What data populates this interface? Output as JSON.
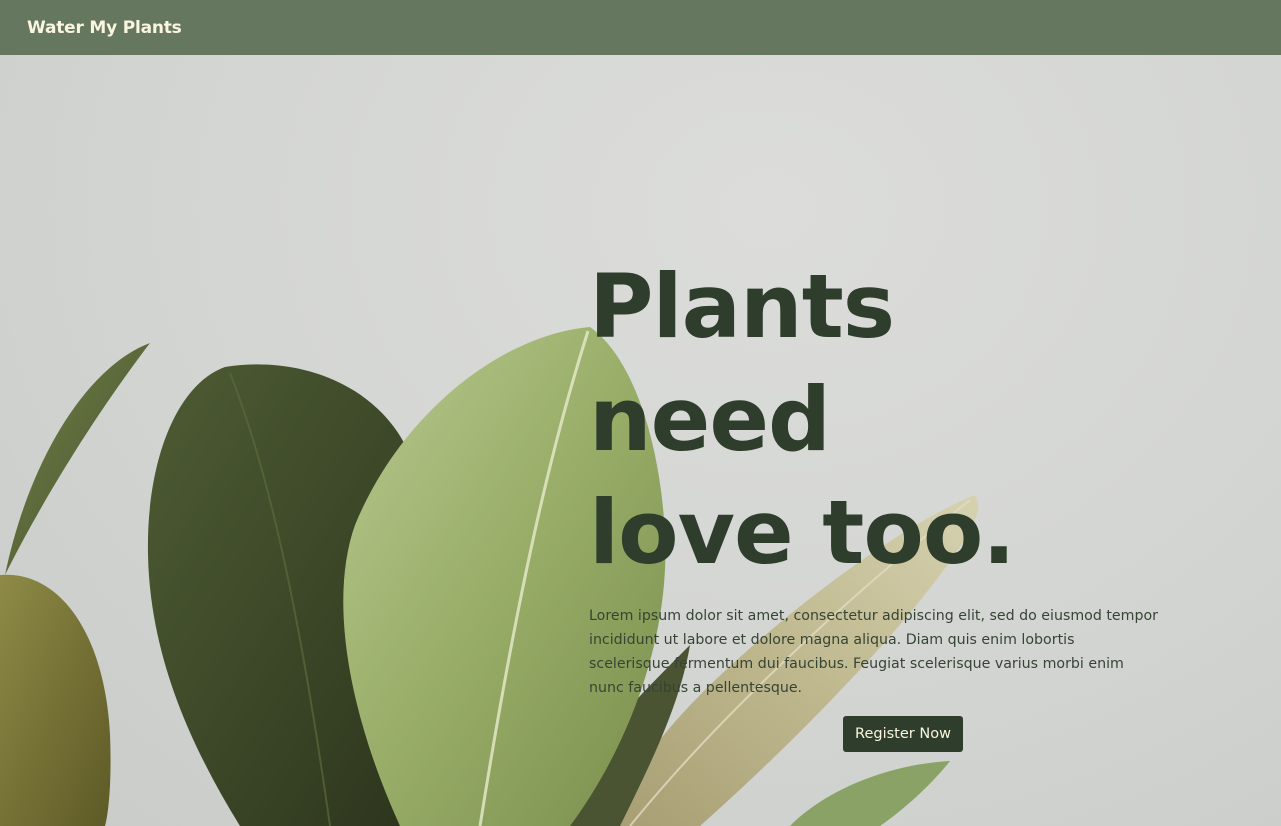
{
  "navbar": {
    "brand": "Water My Plants",
    "background": "#65775f",
    "brand_color": "#fbf5df"
  },
  "hero": {
    "headline_line1": "Plants need",
    "headline_line2": "love too.",
    "body": "Lorem ipsum dolor sit amet, consectetur adipiscing elit, sed do eiusmod tempor incididunt ut labore et dolore magna aliqua. Diam quis enim lobortis scelerisque fermentum dui faucibus. Feugiat scelerisque varius morbi enim nunc faucibus a pellentesque.",
    "cta_label": "Register Now",
    "headline_color": "#2f3d2d",
    "cta_background": "#2f3d2d",
    "image_subject": "green-fiddle-leaf-plant-leaves"
  }
}
